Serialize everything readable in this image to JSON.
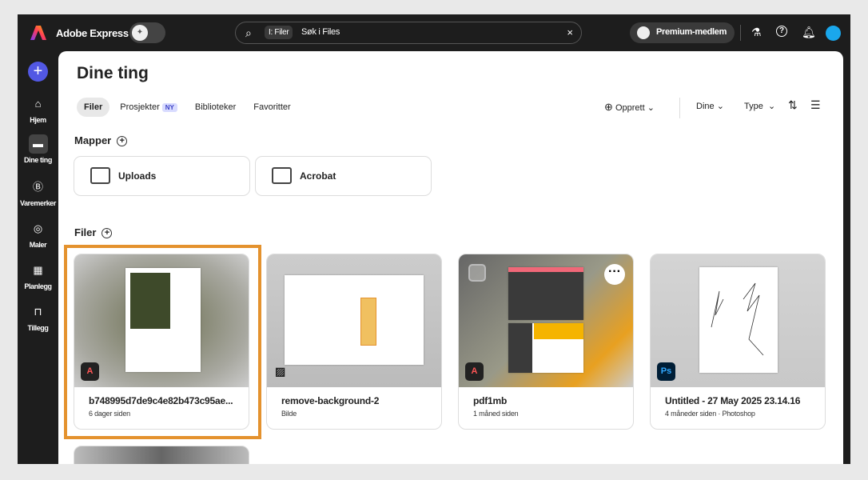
{
  "app": {
    "name": "Adobe Express"
  },
  "search": {
    "chip": "I: Filer",
    "placeholder": "Søk i Files"
  },
  "header": {
    "premium": "Premium-medlem"
  },
  "sidebar": {
    "items": [
      {
        "label": "Hjem",
        "icon": "home-icon"
      },
      {
        "label": "Dine ting",
        "icon": "folder-icon"
      },
      {
        "label": "Varemerker",
        "icon": "brand-icon"
      },
      {
        "label": "Maler",
        "icon": "templates-icon"
      },
      {
        "label": "Planlegg",
        "icon": "calendar-icon"
      },
      {
        "label": "Tillegg",
        "icon": "addons-icon"
      }
    ]
  },
  "page": {
    "title": "Dine ting",
    "tabs": [
      {
        "label": "Filer"
      },
      {
        "label": "Prosjekter",
        "badge": "NY"
      },
      {
        "label": "Biblioteker"
      },
      {
        "label": "Favoritter"
      }
    ],
    "toolbar": {
      "create": "Opprett",
      "owner": "Dine",
      "type": "Type"
    },
    "folders_title": "Mapper",
    "folders": [
      {
        "name": "Uploads"
      },
      {
        "name": "Acrobat"
      }
    ],
    "files_title": "Filer",
    "files": [
      {
        "name": "b748995d7de9c4e82b473c95ae...",
        "meta": "6 dager siden",
        "app": "Adobe Express"
      },
      {
        "name": "remove-background-2",
        "meta": "Bilde",
        "app": "image"
      },
      {
        "name": "pdf1mb",
        "meta": "1 måned siden",
        "app": "Adobe Express"
      },
      {
        "name": "Untitled - 27 May 2025 23.14.16",
        "meta": "4 måneder siden",
        "source": "Photoshop",
        "app": "Ps"
      }
    ]
  },
  "colors": {
    "accent": "#5258e4",
    "highlight": "#e4922e"
  }
}
